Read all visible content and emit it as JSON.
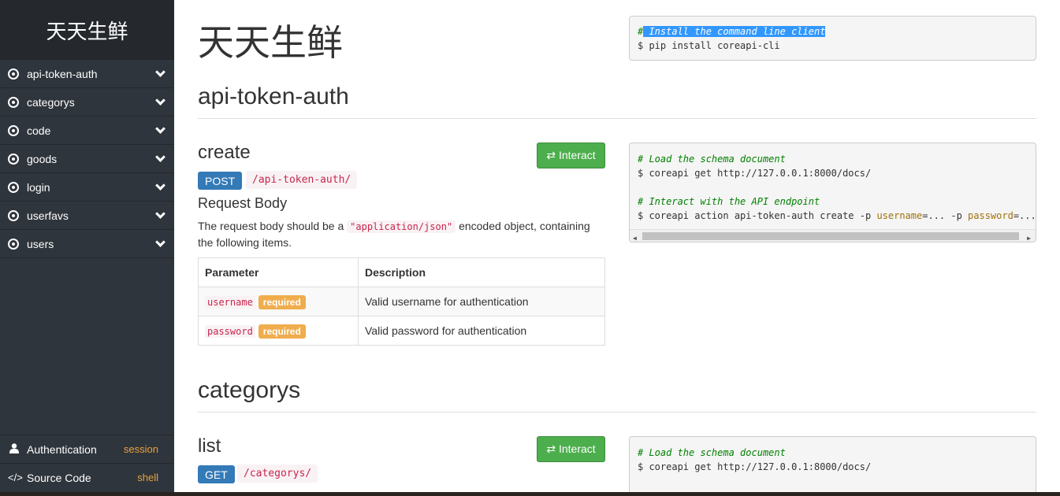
{
  "brand": "天天生鲜",
  "sidebar": {
    "items": [
      {
        "label": "api-token-auth"
      },
      {
        "label": "categorys"
      },
      {
        "label": "code"
      },
      {
        "label": "goods"
      },
      {
        "label": "login"
      },
      {
        "label": "userfavs"
      },
      {
        "label": "users"
      }
    ],
    "authentication": {
      "label": "Authentication",
      "value": "session"
    },
    "source_code": {
      "label": "Source Code",
      "value": "shell"
    }
  },
  "main": {
    "title": "天天生鲜",
    "install": {
      "comment_hash": "#",
      "comment_text": " Install the command line client",
      "command": "$ pip install coreapi-cli"
    },
    "sections": [
      {
        "title": "api-token-auth",
        "endpoint": {
          "title": "create",
          "interact_label": "⇄ Interact",
          "method": "POST",
          "path": "/api-token-auth/",
          "request_body_title": "Request Body",
          "desc_before": "The request body should be a ",
          "desc_code": "\"application/json\"",
          "desc_after": " encoded object, containing the following items.",
          "table": {
            "headers": [
              "Parameter",
              "Description"
            ],
            "rows": [
              {
                "param": "username",
                "required": "required",
                "description": "Valid username for authentication"
              },
              {
                "param": "password",
                "required": "required",
                "description": "Valid password for authentication"
              }
            ]
          },
          "code": {
            "comment1": "# Load the schema document",
            "line1": "$ coreapi get http://127.0.0.1:8000/docs/",
            "comment2": "# Interact with the API endpoint",
            "line2_prefix": "$ coreapi action api-token-auth create -p ",
            "line2_kw1": "username",
            "line2_mid": "=... -p ",
            "line2_kw2": "password",
            "line2_end": "=..."
          }
        }
      },
      {
        "title": "categorys",
        "endpoint": {
          "title": "list",
          "interact_label": "⇄ Interact",
          "method": "GET",
          "path": "/categorys/",
          "code": {
            "comment1": "# Load the schema document",
            "line1": "$ coreapi get http://127.0.0.1:8000/docs/"
          }
        }
      }
    ]
  }
}
